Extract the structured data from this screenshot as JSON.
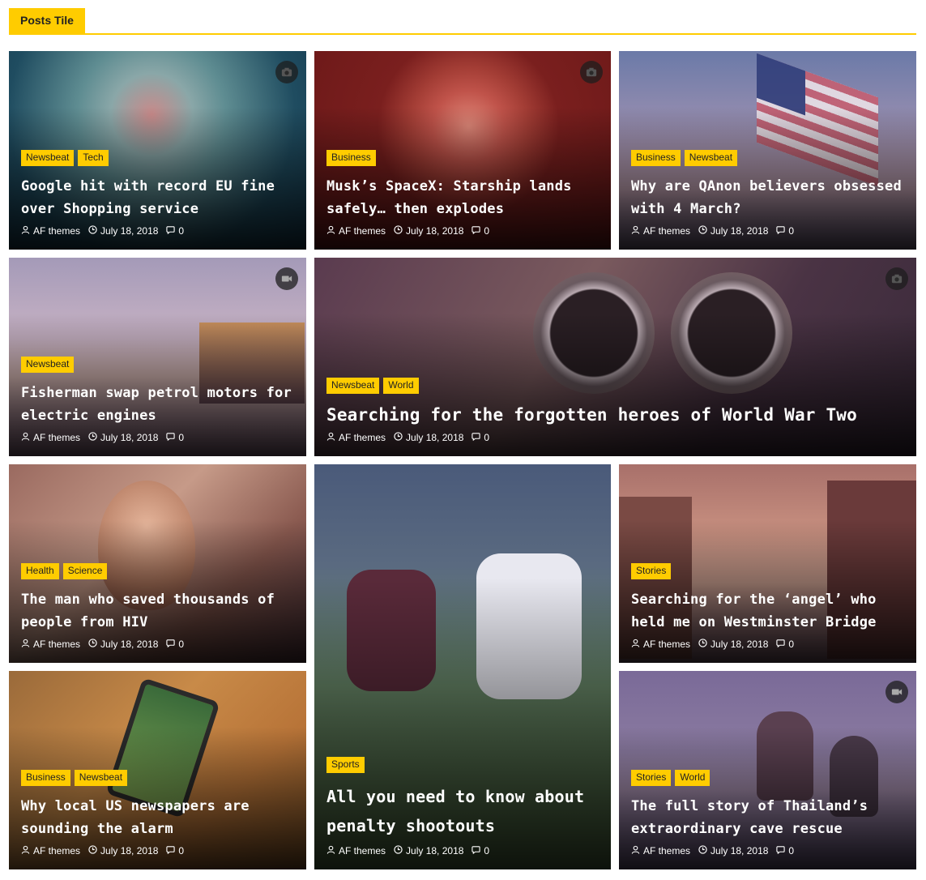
{
  "section": {
    "title": "Posts Tile"
  },
  "colors": {
    "accent": "#ffcc00"
  },
  "posts": [
    {
      "categories": [
        "Newsbeat",
        "Tech"
      ],
      "title": "Google hit with record EU fine over Shopping service",
      "author": "AF themes",
      "date": "July 18, 2018",
      "comments": "0",
      "media_icon": "camera-icon"
    },
    {
      "categories": [
        "Business"
      ],
      "title": "Musk’s SpaceX: Starship lands safely… then explodes",
      "author": "AF themes",
      "date": "July 18, 2018",
      "comments": "0",
      "media_icon": "camera-icon"
    },
    {
      "categories": [
        "Business",
        "Newsbeat"
      ],
      "title": "Why are QAnon believers obsessed with 4 March?",
      "author": "AF themes",
      "date": "July 18, 2018",
      "comments": "0"
    },
    {
      "categories": [
        "Newsbeat"
      ],
      "title": "Fisherman swap petrol motors for electric engines",
      "author": "AF themes",
      "date": "July 18, 2018",
      "comments": "0",
      "media_icon": "video-icon"
    },
    {
      "categories": [
        "Newsbeat",
        "World"
      ],
      "title": "Searching for the forgotten heroes of World War Two",
      "author": "AF themes",
      "date": "July 18, 2018",
      "comments": "0",
      "media_icon": "camera-icon"
    },
    {
      "categories": [
        "Health",
        "Science"
      ],
      "title": "The man who saved thousands of people from HIV",
      "author": "AF themes",
      "date": "July 18, 2018",
      "comments": "0"
    },
    {
      "categories": [
        "Sports"
      ],
      "title": "All you need to know about penalty shootouts",
      "author": "AF themes",
      "date": "July 18, 2018",
      "comments": "0"
    },
    {
      "categories": [
        "Stories"
      ],
      "title": "Searching for the ‘angel’ who held me on Westminster Bridge",
      "author": "AF themes",
      "date": "July 18, 2018",
      "comments": "0"
    },
    {
      "categories": [
        "Business",
        "Newsbeat"
      ],
      "title": "Why local US newspapers are sounding the alarm",
      "author": "AF themes",
      "date": "July 18, 2018",
      "comments": "0"
    },
    {
      "categories": [
        "Stories",
        "World"
      ],
      "title": "The full story of Thailand’s extraordinary cave rescue",
      "author": "AF themes",
      "date": "July 18, 2018",
      "comments": "0",
      "media_icon": "video-icon"
    }
  ]
}
